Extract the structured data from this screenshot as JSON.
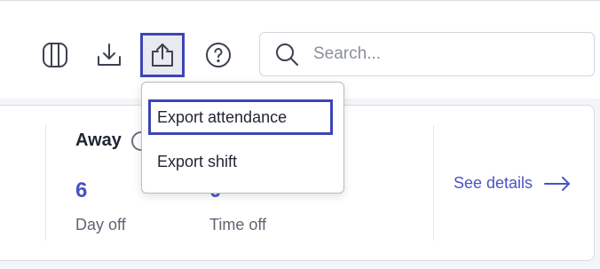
{
  "toolbar": {
    "icons": [
      "columns-icon",
      "download-icon",
      "share-export-icon",
      "help-icon"
    ],
    "active_icon": "share-export-icon"
  },
  "search": {
    "placeholder": "Search..."
  },
  "export_menu": {
    "items": [
      {
        "label": "Export attendance",
        "highlighted": true
      },
      {
        "label": "Export shift",
        "highlighted": false
      }
    ]
  },
  "summary_card": {
    "section_title": "Away",
    "stats": [
      {
        "value": "6",
        "label": "Day off"
      },
      {
        "value": "0",
        "label": "Time off"
      }
    ],
    "see_details_label": "See details"
  },
  "colors": {
    "accent": "#4a52c4",
    "highlight_border": "#3e45b4",
    "text": "#1f2433",
    "muted_text": "#5f6472"
  }
}
